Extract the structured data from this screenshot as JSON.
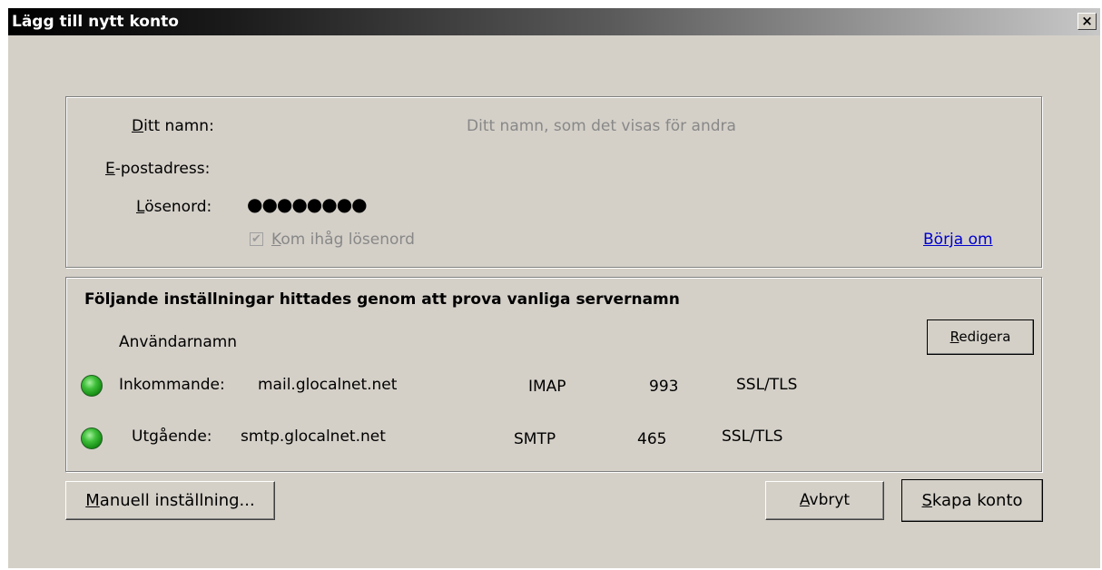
{
  "window": {
    "title": "Lägg till nytt konto",
    "close_glyph": "×"
  },
  "form": {
    "name_label_first": "D",
    "name_label_rest": "itt namn:",
    "name_placeholder": "Ditt namn, som det visas för andra",
    "email_label_first": "E",
    "email_label_rest": "-postadress:",
    "password_label_first": "L",
    "password_label_rest": "ösenord:",
    "password_value": "●●●●●●●●",
    "remember_first": "K",
    "remember_rest": "om ihåg lösenord",
    "remember_checked": true,
    "restart_link": "Börja om"
  },
  "settings": {
    "heading": "Följande inställningar hittades genom att prova vanliga servernamn",
    "username_label": "Användarnamn",
    "edit_button_first": "R",
    "edit_button_rest": "edigera",
    "incoming": {
      "label": "Inkommande:",
      "host": "mail.glocalnet.net",
      "protocol": "IMAP",
      "port": "993",
      "security": "SSL/TLS",
      "status_color": "#2fb52a"
    },
    "outgoing": {
      "label": "Utgående:",
      "host": "smtp.glocalnet.net",
      "protocol": "SMTP",
      "port": "465",
      "security": "SSL/TLS",
      "status_color": "#2fb52a"
    }
  },
  "buttons": {
    "manual_first": "M",
    "manual_rest": "anuell inställning...",
    "cancel_first": "A",
    "cancel_rest": "vbryt",
    "create_first": "S",
    "create_rest": "kapa konto"
  }
}
